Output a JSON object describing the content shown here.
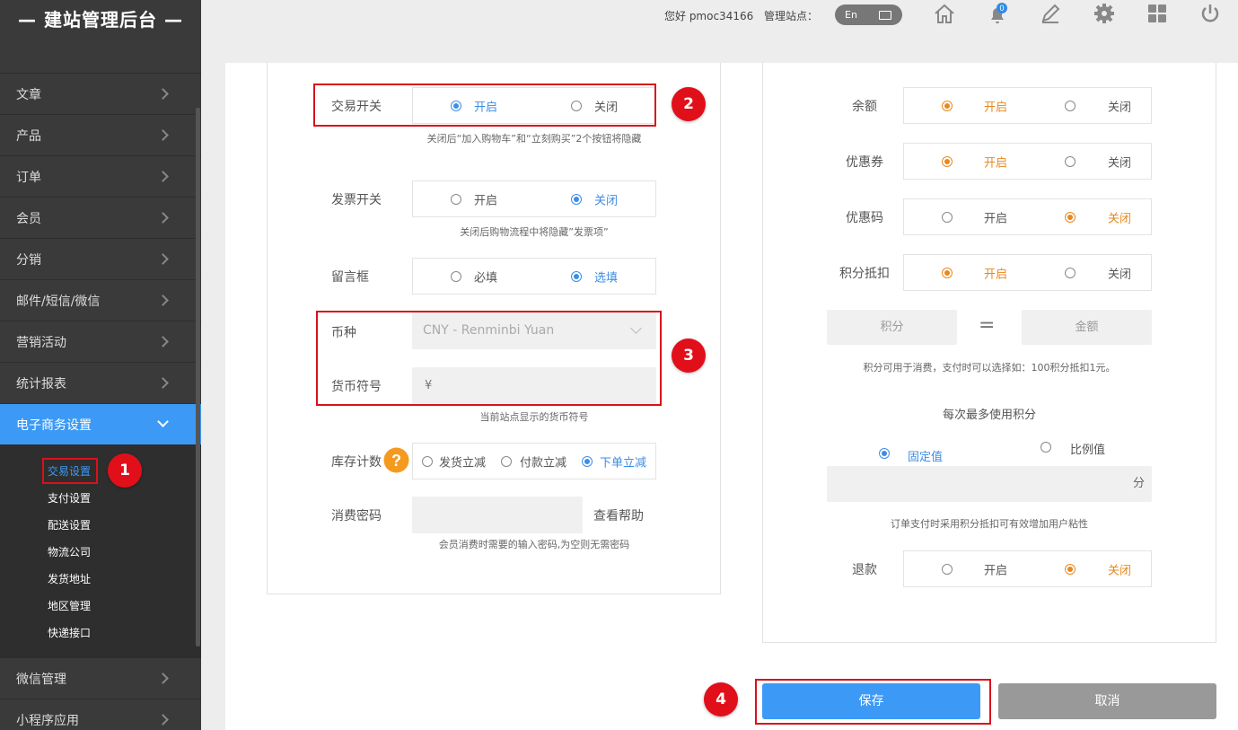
{
  "sidebar": {
    "title": "— 建站管理后台 —",
    "items": [
      {
        "label": "文章"
      },
      {
        "label": "产品"
      },
      {
        "label": "订单"
      },
      {
        "label": "会员"
      },
      {
        "label": "分销"
      },
      {
        "label": "邮件/短信/微信"
      },
      {
        "label": "营销活动"
      },
      {
        "label": "统计报表"
      }
    ],
    "active_item": "电子商务设置",
    "sub_items": [
      "交易设置",
      "支付设置",
      "配送设置",
      "物流公司",
      "发货地址",
      "地区管理",
      "快递接口"
    ],
    "bottom_items": [
      "微信管理",
      "小程序应用"
    ]
  },
  "topbar": {
    "greeting": "您好 pmoc34166",
    "site_label": "管理站点：",
    "lang": "En",
    "notification_count": "0"
  },
  "left": {
    "trade_switch": {
      "label": "交易开关",
      "opt1": "开启",
      "opt2": "关闭",
      "hint": "关闭后“加入购物车”和“立刻购买”2个按钮将隐藏"
    },
    "invoice_switch": {
      "label": "发票开关",
      "opt1": "开启",
      "opt2": "关闭",
      "hint": "关闭后购物流程中将隐藏”发票项”"
    },
    "message_box": {
      "label": "留言框",
      "opt1": "必填",
      "opt2": "选填"
    },
    "currency": {
      "label": "币种",
      "value": "CNY - Renminbi Yuan"
    },
    "currency_symbol": {
      "label": "货币符号",
      "value": "¥",
      "hint": "当前站点显示的货币符号"
    },
    "stock": {
      "label": "库存计数",
      "opt1": "发货立减",
      "opt2": "付款立减",
      "opt3": "下单立减"
    },
    "pay_password": {
      "label": "消费密码",
      "help": "查看帮助",
      "hint": "会员消费时需要的输入密码,为空则无需密码"
    }
  },
  "right": {
    "balance": {
      "label": "余额",
      "opt1": "开启",
      "opt2": "关闭"
    },
    "coupon": {
      "label": "优惠券",
      "opt1": "开启",
      "opt2": "关闭"
    },
    "promo_code": {
      "label": "优惠码",
      "opt1": "开启",
      "opt2": "关闭"
    },
    "points_deduct": {
      "label": "积分抵扣",
      "opt1": "开启",
      "opt2": "关闭"
    },
    "points_placeholder": "积分",
    "equals": "=",
    "amount_placeholder": "金额",
    "points_hint": "积分可用于消费，支付时可以选择如：100积分抵扣1元。",
    "max_points_title": "每次最多使用积分",
    "fixed": "固定值",
    "ratio": "比例值",
    "unit": "分",
    "max_hint": "订单支付时采用积分抵扣可有效增加用户粘性",
    "refund": {
      "label": "退款",
      "opt1": "开启",
      "opt2": "关闭"
    }
  },
  "buttons": {
    "save": "保存",
    "cancel": "取消"
  },
  "callouts": [
    "1",
    "2",
    "3",
    "4"
  ],
  "colors": {
    "accent": "#3c9af6",
    "orange": "#e8881e",
    "callout": "#e10f1a",
    "sidebar": "#3a3a3a"
  }
}
